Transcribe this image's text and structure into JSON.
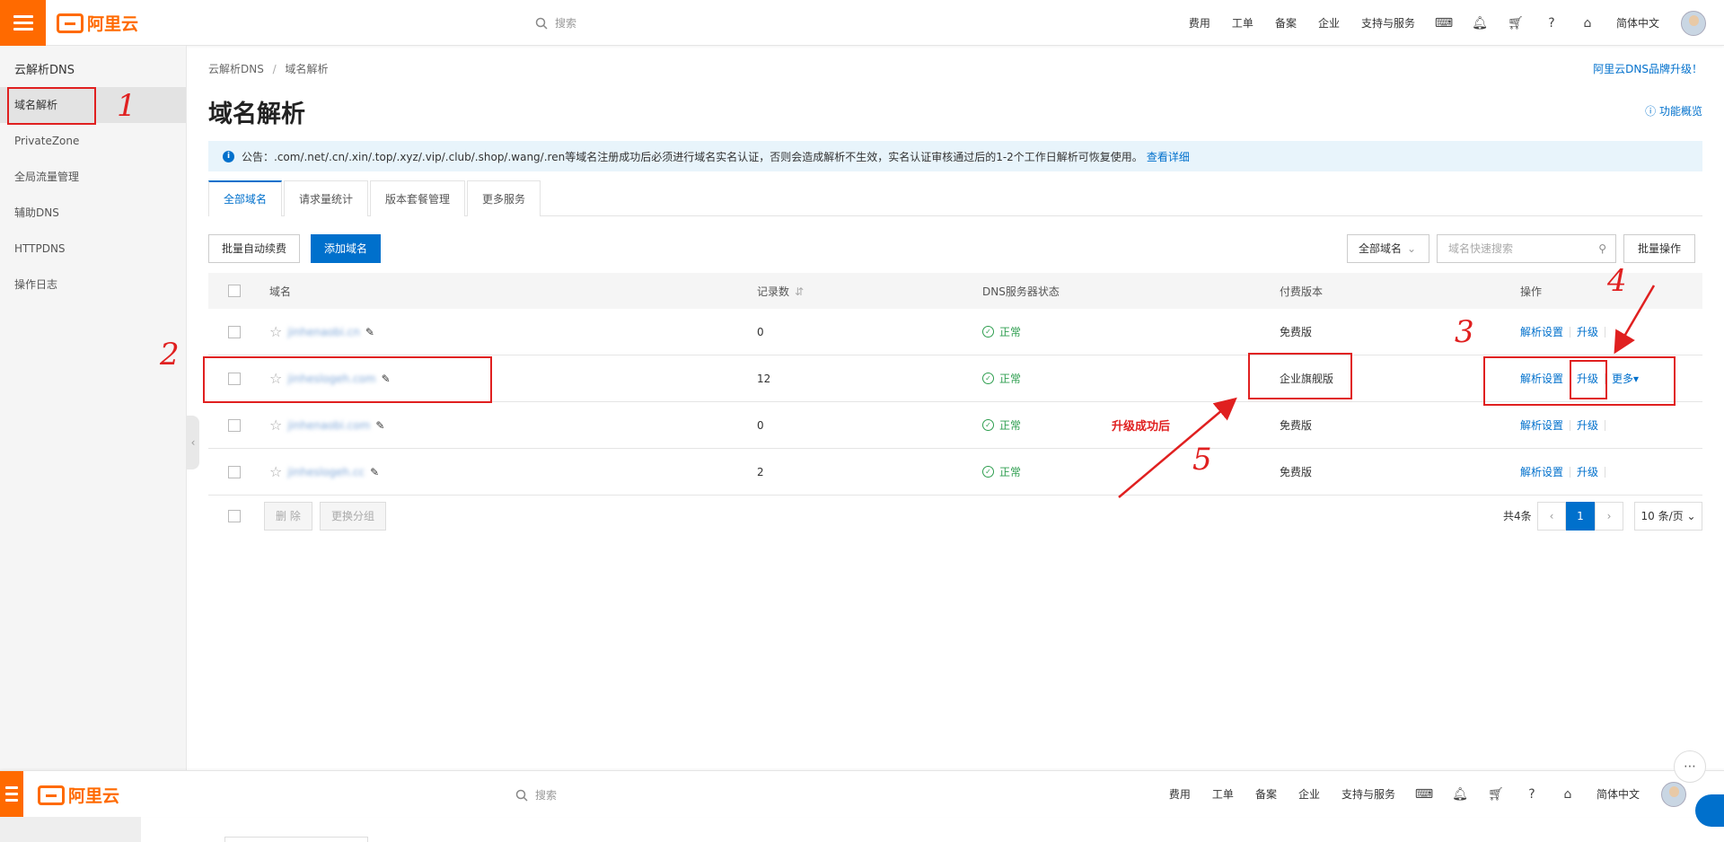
{
  "topbar": {
    "search_placeholder": "搜索",
    "nav": [
      "费用",
      "工单",
      "备案",
      "企业",
      "支持与服务"
    ],
    "lang": "简体中文"
  },
  "brand": "阿里云",
  "sidebar": {
    "title": "云解析DNS",
    "items": [
      "域名解析",
      "PrivateZone",
      "全局流量管理",
      "辅助DNS",
      "HTTPDNS",
      "操作日志"
    ]
  },
  "main": {
    "breadcrumb": [
      "云解析DNS",
      "域名解析"
    ],
    "brand_upgrade": "阿里云DNS品牌升级！",
    "title": "域名解析",
    "overview": "功能概览",
    "notice": "公告：.com/.net/.cn/.xin/.top/.xyz/.vip/.club/.shop/.wang/.ren等域名注册成功后必须进行域名实名认证，否则会造成解析不生效，实名认证审核通过后的1-2个工作日解析可恢复使用。",
    "notice_link": "查看详细",
    "tabs": [
      "全部域名",
      "请求量统计",
      "版本套餐管理",
      "更多服务"
    ],
    "buttons": {
      "batch_renew": "批量自动续费",
      "add_domain": "添加域名",
      "filter": "全部域名",
      "search_placeholder": "域名快速搜索",
      "batch_ops": "批量操作"
    },
    "table": {
      "headers": [
        "域名",
        "记录数",
        "DNS服务器状态",
        "付费版本",
        "操作"
      ],
      "rows": [
        {
          "domain": "jinhenaobi.cn",
          "records": "0",
          "status": "正常",
          "plan": "免费版",
          "actions": [
            "解析设置",
            "升级"
          ]
        },
        {
          "domain": "jinheslogeh.com",
          "records": "12",
          "status": "正常",
          "plan": "企业旗舰版",
          "actions": [
            "解析设置",
            "升级",
            "更多"
          ]
        },
        {
          "domain": "jinhenaobi.com",
          "records": "0",
          "status": "正常",
          "plan": "免费版",
          "actions": [
            "解析设置",
            "升级"
          ]
        },
        {
          "domain": "jinheslogeh.cc",
          "records": "2",
          "status": "正常",
          "plan": "免费版",
          "actions": [
            "解析设置",
            "升级"
          ]
        }
      ]
    },
    "footer": {
      "delete": "删 除",
      "change_group": "更换分组",
      "total": "共4条",
      "page": "1",
      "page_size": "10 条/页"
    }
  },
  "annotations": {
    "n1": "1",
    "n2": "2",
    "n3": "3",
    "n4": "4",
    "n5": "5",
    "after_upgrade": "升级成功后"
  },
  "colors": {
    "brand": "#ff6a00",
    "link": "#0070cc",
    "ok": "#2e9e4f",
    "annotation": "#e02020"
  }
}
